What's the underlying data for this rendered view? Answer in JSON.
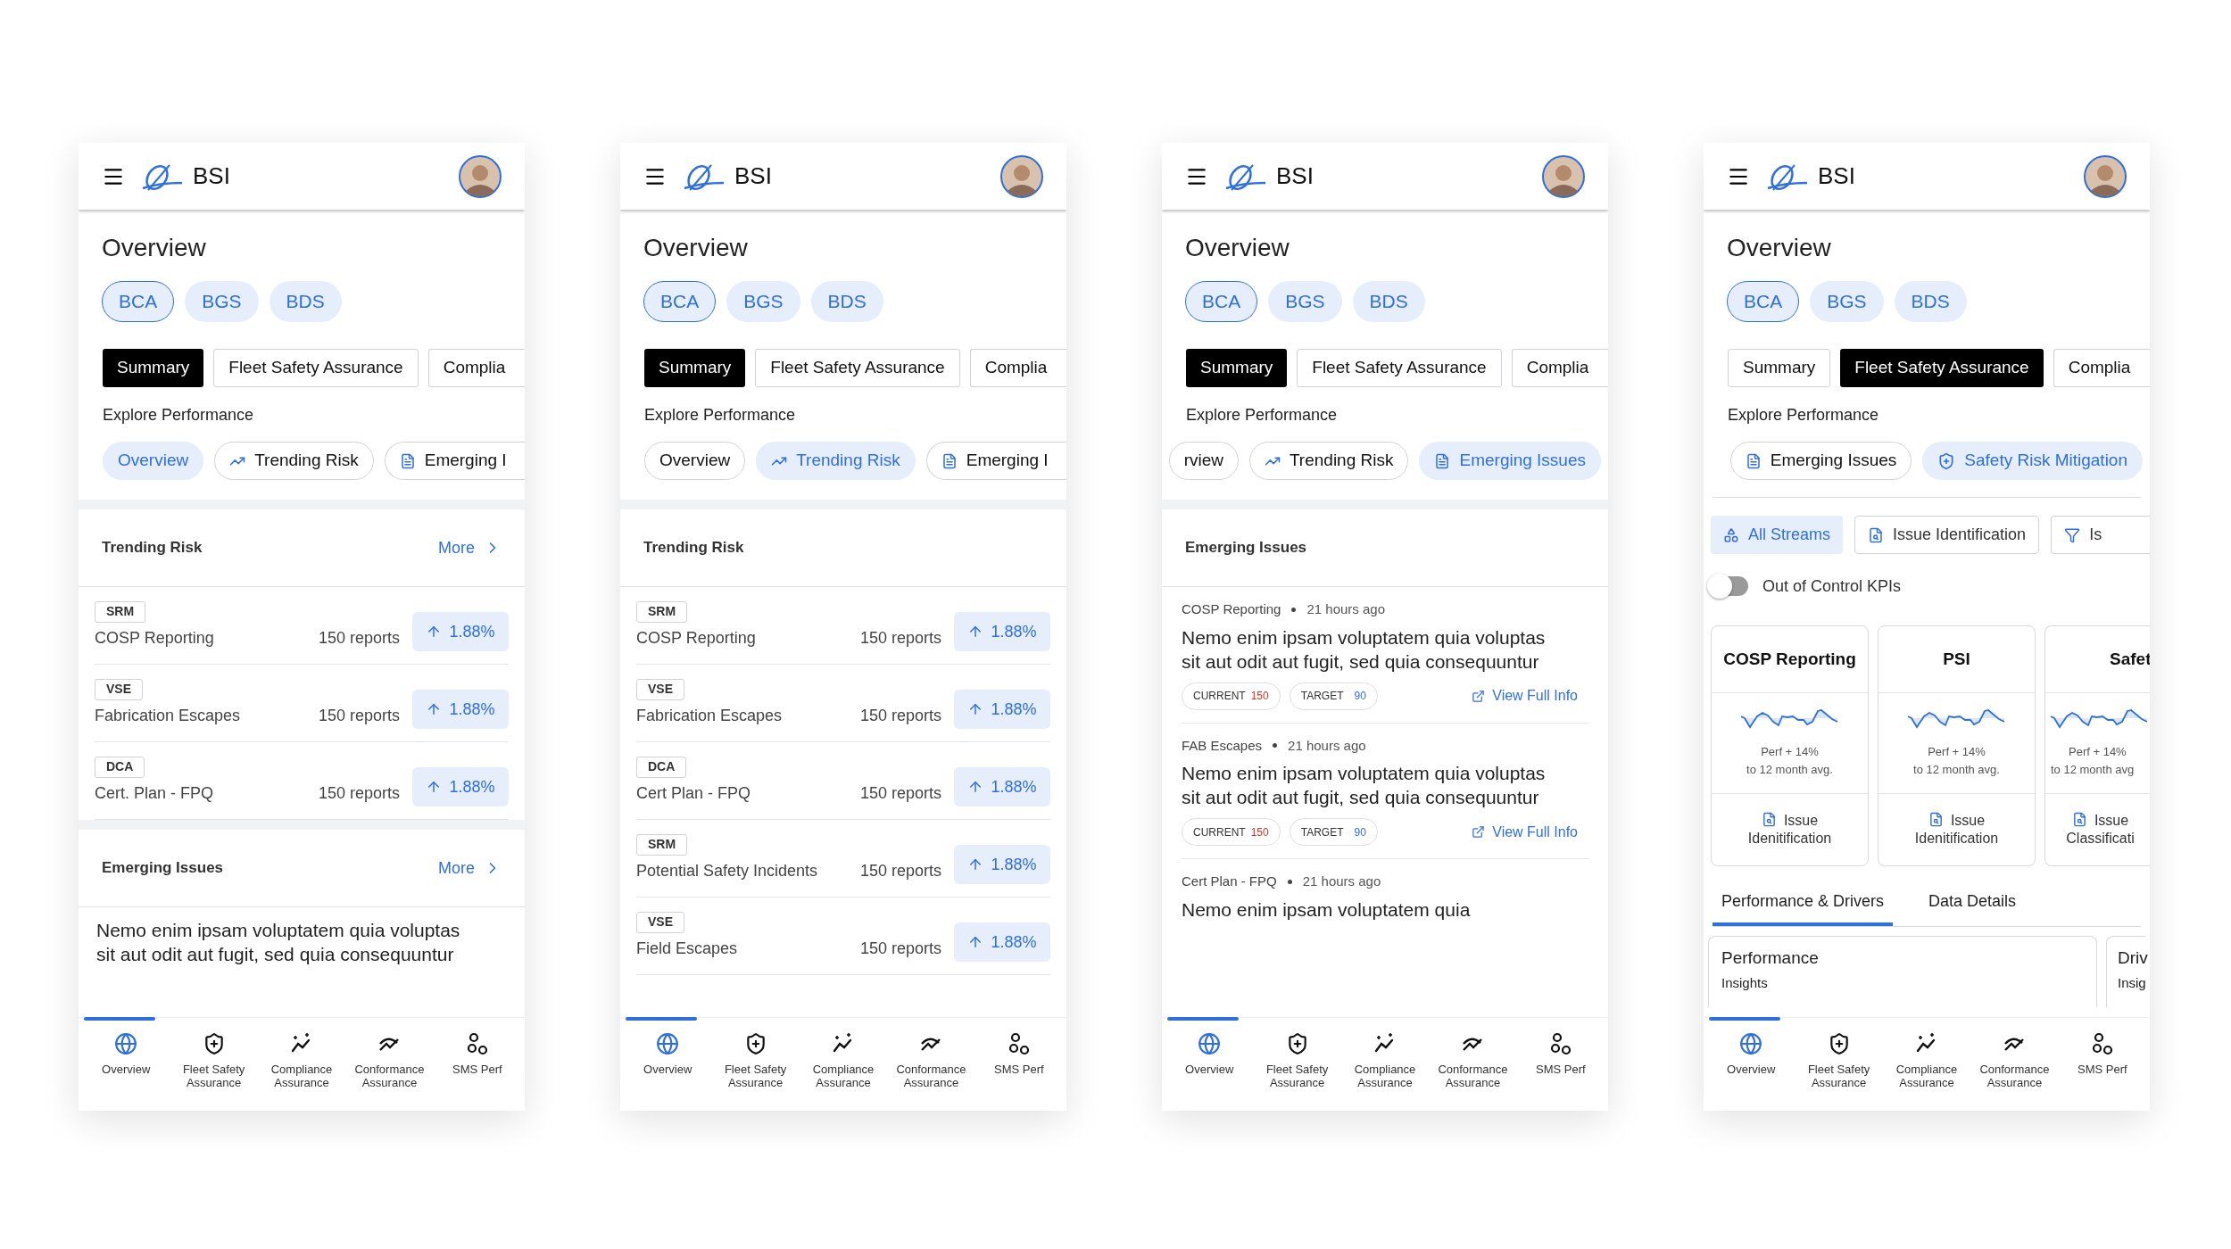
{
  "screens": [
    {
      "header": {
        "brand": "BSI"
      },
      "title": "Overview",
      "business_units": [
        {
          "label": "BCA",
          "selected": true
        },
        {
          "label": "BGS",
          "selected": false
        },
        {
          "label": "BDS",
          "selected": false
        }
      ],
      "tabs": [
        {
          "label": "Summary",
          "selected": true
        },
        {
          "label": "Fleet Safety Assurance",
          "selected": false
        },
        {
          "label": "Complia",
          "selected": false
        }
      ],
      "explore_label": "Explore Performance",
      "explore_scrolled": false,
      "explore_pills": [
        {
          "kind": "overview",
          "label": "Overview",
          "selected": true
        },
        {
          "kind": "trending",
          "label": "Trending Risk",
          "selected": false
        },
        {
          "kind": "emerging",
          "label": "Emerging I",
          "selected": false
        }
      ],
      "sections": [
        {
          "kind": "trending",
          "title": "Trending Risk",
          "more": "More",
          "rows": [
            {
              "tag": "SRM",
              "name": "COSP Reporting",
              "reports": "150 reports",
              "change": "1.88%"
            },
            {
              "tag": "VSE",
              "name": "Fabrication Escapes",
              "reports": "150 reports",
              "change": "1.88%"
            },
            {
              "tag": "DCA",
              "name": "Cert. Plan - FPQ",
              "reports": "150 reports",
              "change": "1.88%"
            }
          ]
        },
        {
          "kind": "emerging_preview",
          "title": "Emerging Issues",
          "more": "More",
          "text": "Nemo enim ipsam voluptatem quia voluptas sit  aut odit aut fugit, sed quia consequuntur"
        }
      ],
      "bottom_nav": [
        {
          "label": "Overview",
          "selected": true
        },
        {
          "label": "Fleet Safety Assurance",
          "selected": false
        },
        {
          "label": "Compliance Assurance",
          "selected": false
        },
        {
          "label": "Conformance Assurance",
          "selected": false
        },
        {
          "label": "SMS Perf",
          "selected": false
        }
      ]
    },
    {
      "header": {
        "brand": "BSI"
      },
      "title": "Overview",
      "business_units": [
        {
          "label": "BCA",
          "selected": true
        },
        {
          "label": "BGS",
          "selected": false
        },
        {
          "label": "BDS",
          "selected": false
        }
      ],
      "tabs": [
        {
          "label": "Summary",
          "selected": true
        },
        {
          "label": "Fleet Safety Assurance",
          "selected": false
        },
        {
          "label": "Complia",
          "selected": false
        }
      ],
      "explore_label": "Explore Performance",
      "explore_scrolled": false,
      "explore_pills": [
        {
          "kind": "overview",
          "label": "Overview",
          "selected": false
        },
        {
          "kind": "trending",
          "label": "Trending Risk",
          "selected": true
        },
        {
          "kind": "emerging",
          "label": "Emerging I",
          "selected": false
        }
      ],
      "sections": [
        {
          "kind": "trending",
          "title": "Trending Risk",
          "rows": [
            {
              "tag": "SRM",
              "name": "COSP Reporting",
              "reports": "150 reports",
              "change": "1.88%"
            },
            {
              "tag": "VSE",
              "name": "Fabrication Escapes",
              "reports": "150 reports",
              "change": "1.88%"
            },
            {
              "tag": "DCA",
              "name": "Cert Plan - FPQ",
              "reports": "150 reports",
              "change": "1.88%"
            },
            {
              "tag": "SRM",
              "name": "Potential Safety Incidents",
              "reports": "150 reports",
              "change": "1.88%"
            },
            {
              "tag": "VSE",
              "name": "Field Escapes",
              "reports": "150 reports",
              "change": "1.88%"
            }
          ]
        }
      ],
      "bottom_nav": [
        {
          "label": "Overview",
          "selected": true
        },
        {
          "label": "Fleet Safety Assurance",
          "selected": false
        },
        {
          "label": "Compliance Assurance",
          "selected": false
        },
        {
          "label": "Conformance Assurance",
          "selected": false
        },
        {
          "label": "SMS Perf",
          "selected": false
        }
      ]
    },
    {
      "header": {
        "brand": "BSI"
      },
      "title": "Overview",
      "business_units": [
        {
          "label": "BCA",
          "selected": true
        },
        {
          "label": "BGS",
          "selected": false
        },
        {
          "label": "BDS",
          "selected": false
        }
      ],
      "tabs": [
        {
          "label": "Summary",
          "selected": true
        },
        {
          "label": "Fleet Safety Assurance",
          "selected": false
        },
        {
          "label": "Complia",
          "selected": false
        }
      ],
      "explore_label": "Explore Performance",
      "explore_scrolled": true,
      "explore_pills": [
        {
          "kind": "overview",
          "label": "rview",
          "selected": false
        },
        {
          "kind": "trending",
          "label": "Trending Risk",
          "selected": false
        },
        {
          "kind": "emerging",
          "label": "Emerging Issues",
          "selected": true
        }
      ],
      "sections": [
        {
          "kind": "emerging_list",
          "title": "Emerging Issues",
          "items": [
            {
              "source": "COSP Reporting",
              "time": "21 hours ago",
              "text": "Nemo enim ipsam voluptatem quia voluptas sit  aut odit aut fugit, sed quia consequuntur",
              "current_label": "CURRENT",
              "current_value": "150",
              "target_label": "TARGET",
              "target_value": "90",
              "link": "View Full Info"
            },
            {
              "source": "FAB Escapes",
              "time": "21 hours ago",
              "text": "Nemo enim ipsam voluptatem quia voluptas sit  aut odit aut fugit, sed quia consequuntur",
              "current_label": "CURRENT",
              "current_value": "150",
              "target_label": "TARGET",
              "target_value": "90",
              "link": "View Full Info"
            },
            {
              "source": "Cert Plan - FPQ",
              "time": "21 hours ago",
              "text": "Nemo enim ipsam voluptatem quia"
            }
          ]
        }
      ],
      "bottom_nav": [
        {
          "label": "Overview",
          "selected": true
        },
        {
          "label": "Fleet Safety Assurance",
          "selected": false
        },
        {
          "label": "Compliance Assurance",
          "selected": false
        },
        {
          "label": "Conformance Assurance",
          "selected": false
        },
        {
          "label": "SMS Perf",
          "selected": false
        }
      ]
    },
    {
      "header": {
        "brand": "BSI"
      },
      "title": "Overview",
      "business_units": [
        {
          "label": "BCA",
          "selected": true
        },
        {
          "label": "BGS",
          "selected": false
        },
        {
          "label": "BDS",
          "selected": false
        }
      ],
      "tabs": [
        {
          "label": "Summary",
          "selected": false
        },
        {
          "label": "Fleet Safety Assurance",
          "selected": true
        },
        {
          "label": "Complia",
          "selected": false
        }
      ],
      "explore_label": "Explore Performance",
      "explore_scrolled": true,
      "explore_pills": [
        {
          "kind": "emerging",
          "label": "Emerging Issues",
          "selected": false
        },
        {
          "kind": "mitigation",
          "label": "Safety Risk Mitigation",
          "selected": true
        }
      ],
      "sections": [
        {
          "kind": "kpi",
          "filters": [
            {
              "kind": "streams",
              "label": "All Streams",
              "selected": true
            },
            {
              "kind": "issue",
              "label": "Issue Identification",
              "selected": false
            },
            {
              "kind": "filter",
              "label": "Is",
              "selected": false
            }
          ],
          "toggle": {
            "label": "Out of Control KPIs",
            "on": false
          },
          "cards": [
            {
              "title": "COSP Reporting",
              "perf": "Perf + 14%",
              "note": "to 12 month avg.",
              "link": "Issue Idenitification"
            },
            {
              "title": "PSI",
              "perf": "Perf + 14%",
              "note": "to 12 month avg.",
              "link": "Issue Idenitification"
            },
            {
              "title": "Safet",
              "perf": "Perf + 14%",
              "note": "to 12 month avg",
              "link": "Issue Classificati"
            }
          ],
          "sub_tabs": [
            {
              "label": "Performance & Drivers",
              "selected": true
            },
            {
              "label": "Data Details",
              "selected": false
            }
          ],
          "insights": [
            {
              "title": "Performance",
              "subtitle": "Insights"
            },
            {
              "title": "Driv",
              "subtitle": "Insig"
            }
          ]
        }
      ],
      "bottom_nav": [
        {
          "label": "Overview",
          "selected": true
        },
        {
          "label": "Fleet Safety Assurance",
          "selected": false
        },
        {
          "label": "Compliance Assurance",
          "selected": false
        },
        {
          "label": "Conformance Assurance",
          "selected": false
        },
        {
          "label": "SMS Perf",
          "selected": false
        }
      ]
    }
  ]
}
